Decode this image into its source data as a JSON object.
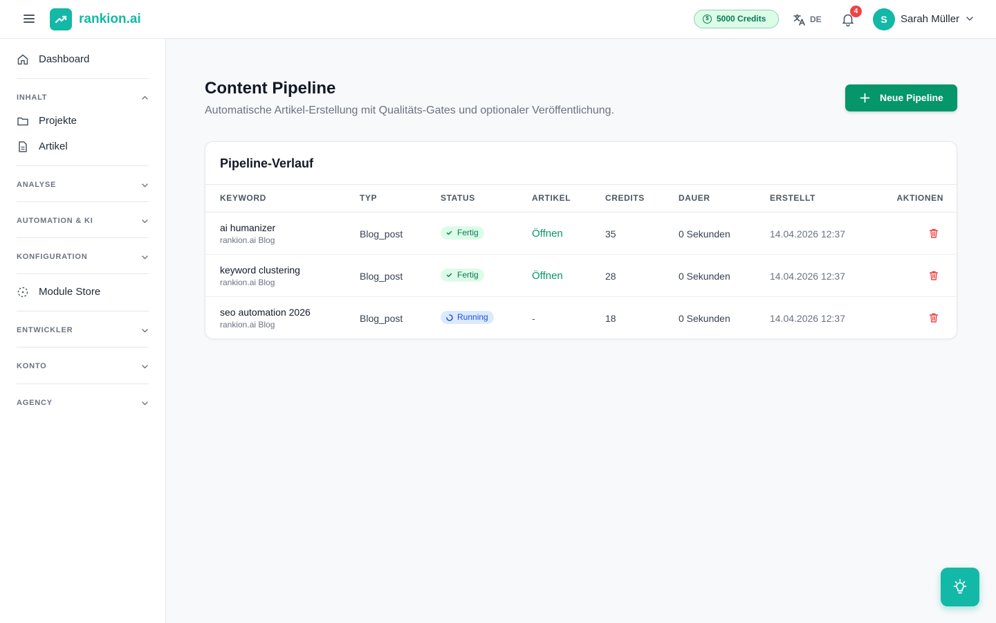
{
  "header": {
    "brand": "rankion.ai",
    "credits": "5000 Credits",
    "language": "DE",
    "notifications_count": "4",
    "user_initial": "S",
    "user_name": "Sarah Müller"
  },
  "sidebar": {
    "dashboard": "Dashboard",
    "sections": {
      "inhalt": "INHALT",
      "analyse": "ANALYSE",
      "automation": "AUTOMATION & KI",
      "konfiguration": "KONFIGURATION",
      "entwickler": "ENTWICKLER",
      "konto": "KONTO",
      "agency": "AGENCY"
    },
    "projekte": "Projekte",
    "artikel": "Artikel",
    "module_store": "Module Store"
  },
  "main": {
    "title": "Content Pipeline",
    "subtitle": "Automatische Artikel-Erstellung mit Qualitäts-Gates und optionaler Veröffentlichung.",
    "new_button": "Neue Pipeline",
    "card_title": "Pipeline-Verlauf",
    "columns": [
      "KEYWORD",
      "TYP",
      "STATUS",
      "ARTIKEL",
      "CREDITS",
      "DAUER",
      "ERSTELLT",
      "AKTIONEN"
    ],
    "rows": [
      {
        "keyword": "ai humanizer",
        "site": "rankion.ai Blog",
        "type": "Blog_post",
        "status": "Fertig",
        "article": "Öffnen",
        "credits": "35",
        "duration": "0 Sekunden",
        "created": "14.04.2026 12:37"
      },
      {
        "keyword": "keyword clustering",
        "site": "rankion.ai Blog",
        "type": "Blog_post",
        "status": "Fertig",
        "article": "Öffnen",
        "credits": "28",
        "duration": "0 Sekunden",
        "created": "14.04.2026 12:37"
      },
      {
        "keyword": "seo automation 2026",
        "site": "rankion.ai Blog",
        "type": "Blog_post",
        "status": "Running",
        "article": "-",
        "credits": "18",
        "duration": "0 Sekunden",
        "created": "14.04.2026 12:37"
      }
    ]
  },
  "colors": {
    "brand": "#14b8a6",
    "primary_button": "#059669",
    "done_badge_bg": "#dcfce7",
    "running_badge_bg": "#dbeafe",
    "danger": "#ef4444"
  },
  "icons": [
    "menu-icon",
    "trend-up-icon",
    "coin-icon",
    "translate-icon",
    "bell-icon",
    "chevron-down-icon",
    "home-icon",
    "chevron-up-icon",
    "folder-icon",
    "document-icon",
    "module-icon",
    "plus-icon",
    "check-icon",
    "spinner-icon",
    "trash-icon",
    "lightbulb-icon"
  ]
}
